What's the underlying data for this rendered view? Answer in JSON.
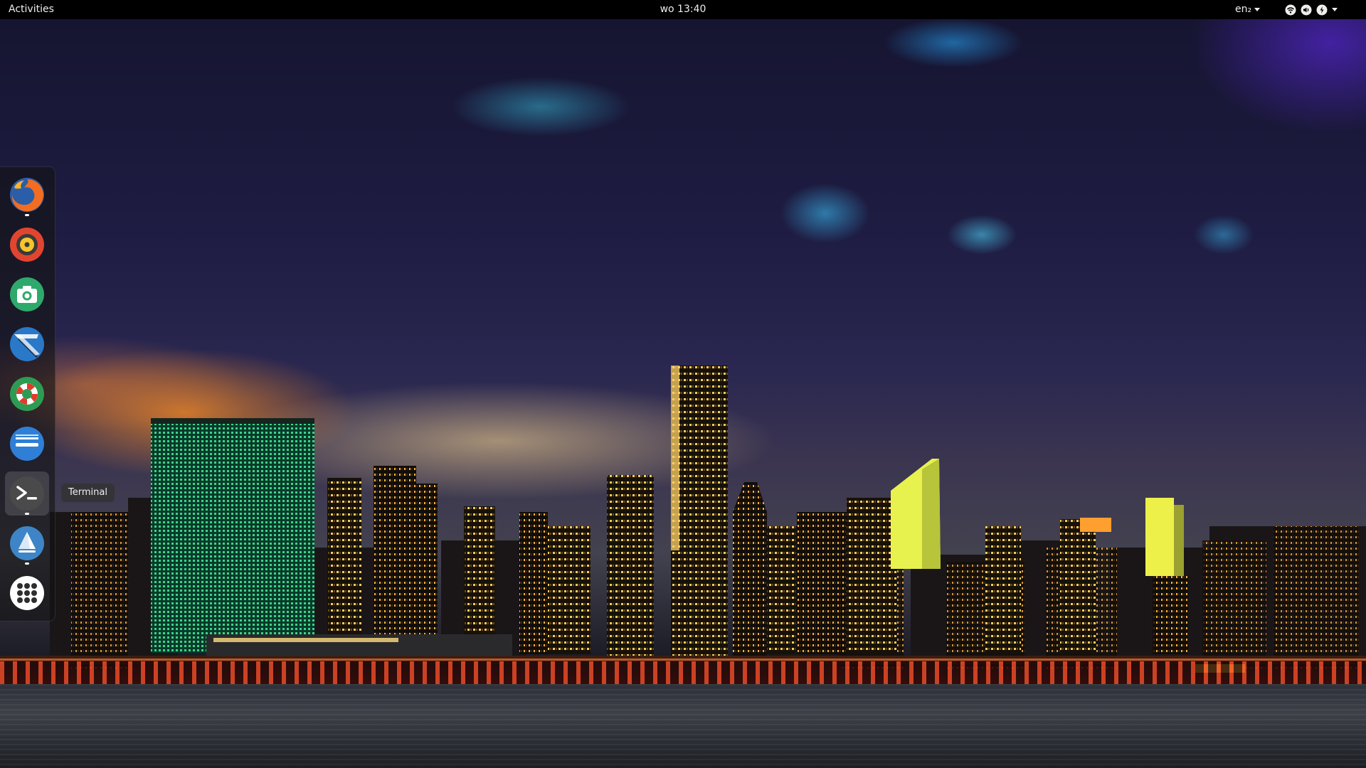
{
  "topbar": {
    "activities_label": "Activities",
    "clock_text": "wo 13:40",
    "input_source": "en₂",
    "status_icons": [
      "network-icon",
      "volume-icon",
      "power-icon"
    ]
  },
  "dock": {
    "items": [
      {
        "name": "Firefox",
        "icon": "firefox-icon"
      },
      {
        "name": "Rhythmbox",
        "icon": "rhythmbox-icon"
      },
      {
        "name": "Cheese",
        "icon": "camera-icon"
      },
      {
        "name": "Text Editor",
        "icon": "text-editor-icon"
      },
      {
        "name": "Help",
        "icon": "lifebuoy-icon"
      },
      {
        "name": "Software Updater",
        "icon": "update-icon"
      },
      {
        "name": "Terminal",
        "icon": "terminal-icon"
      },
      {
        "name": "Backups",
        "icon": "backup-icon"
      },
      {
        "name": "Show Applications",
        "icon": "app-grid-icon"
      }
    ],
    "tooltip": "Terminal"
  },
  "colors": {
    "topbar_bg": "#000000",
    "topbar_text": "#eeeeec",
    "dock_bg": "rgba(20,20,20,0.62)"
  }
}
